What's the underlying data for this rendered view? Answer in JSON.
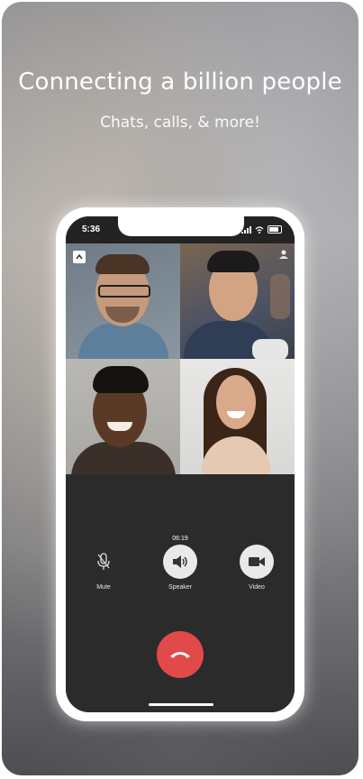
{
  "hero": {
    "title": "Connecting a billion people",
    "subtitle": "Chats, calls, & more!"
  },
  "phone": {
    "status_time": "5:36",
    "call_timer": "06:19",
    "controls": [
      {
        "label": "Mute",
        "icon": "microphone-icon"
      },
      {
        "label": "Speaker",
        "icon": "speaker-icon"
      },
      {
        "label": "Video",
        "icon": "video-camera-icon"
      }
    ],
    "end_call_icon": "phone-hangup-icon",
    "accent_end_call": "#e24a4a"
  }
}
